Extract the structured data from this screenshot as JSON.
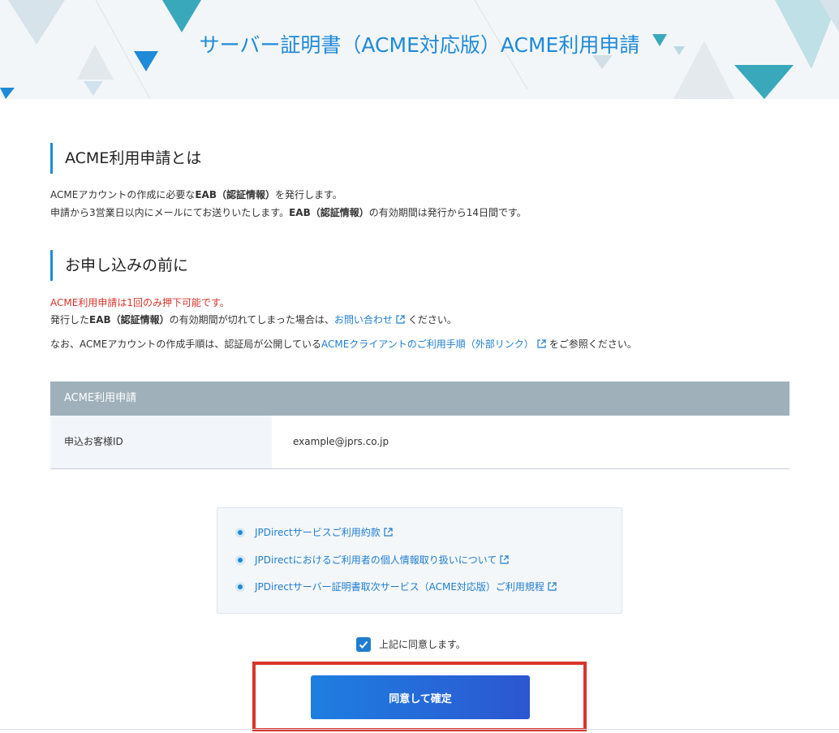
{
  "header": {
    "title": "サーバー証明書（ACME対応版）ACME利用申請"
  },
  "about": {
    "heading": "ACME利用申請とは",
    "line1_prefix": "ACMEアカウントの作成に必要な",
    "line1_bold": "EAB（認証情報）",
    "line1_suffix": "を発行します。",
    "line2_prefix": "申請から3営業日以内にメールにてお送りいたします。",
    "line2_bold": "EAB（認証情報）",
    "line2_suffix": "の有効期間は発行から14日間です。"
  },
  "before": {
    "heading": "お申し込みの前に",
    "warning": "ACME利用申請は1回のみ押下可能です。",
    "line2_prefix": "発行した",
    "line2_bold": "EAB（認証情報）",
    "line2_middle": "の有効期間が切れてしまった場合は、",
    "contact_link": "お問い合わせ",
    "line2_suffix": "ください。",
    "line3_prefix": "なお、ACMEアカウントの作成手順は、認証局が公開している",
    "client_link": "ACMEクライアントのご利用手順（外部リンク）",
    "line3_suffix": "をご参照ください。"
  },
  "table": {
    "header": "ACME利用申請",
    "label": "申込お客様ID",
    "value": "example@jprs.co.jp"
  },
  "terms": [
    {
      "label": "JPDirectサービスご利用約款"
    },
    {
      "label": "JPDirectにおけるご利用者の個人情報取り扱いについて"
    },
    {
      "label": "JPDirectサーバー証明書取次サービス（ACME対応版）ご利用規程"
    }
  ],
  "agree": {
    "label": "上記に同意します。",
    "checked": true
  },
  "confirm": {
    "label": "同意して確定"
  },
  "colors": {
    "accent": "#1f8ad8",
    "teal": "#3aa8bb",
    "warning": "#d9342b",
    "table_header": "#9fb0ba"
  }
}
